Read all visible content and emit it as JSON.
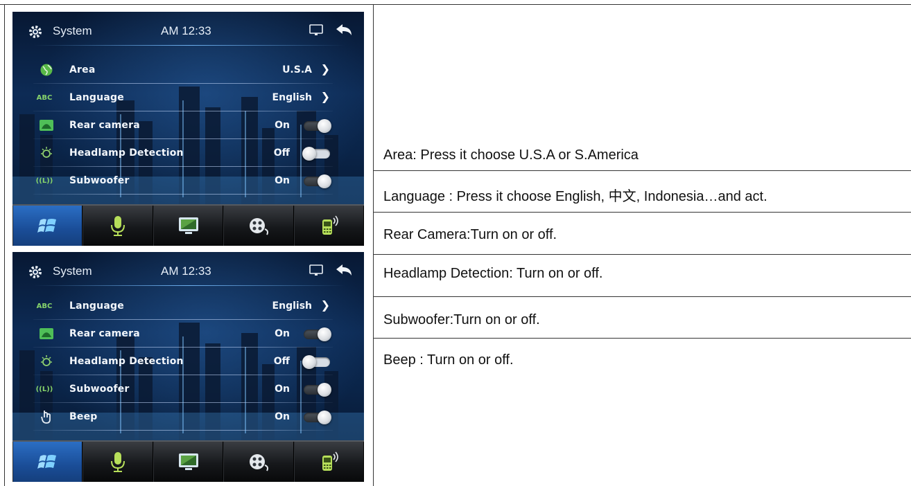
{
  "screens": [
    {
      "title": "System",
      "clock": "AM 12:33",
      "rows": [
        {
          "icon": "globe-icon",
          "label": "Area",
          "value": "U.S.A",
          "control": "chevron"
        },
        {
          "icon": "abc-icon",
          "icon_text": "ABC",
          "label": "Language",
          "value": "English",
          "control": "chevron"
        },
        {
          "icon": "camera-icon",
          "label": "Rear camera",
          "value": "On",
          "control": "toggle",
          "state": "on"
        },
        {
          "icon": "headlamp-icon",
          "label": "Headlamp Detection",
          "value": "Off",
          "control": "toggle",
          "state": "off"
        },
        {
          "icon": "subwoofer-icon",
          "icon_text": "((L))",
          "label": "Subwoofer",
          "value": "On",
          "control": "toggle",
          "state": "on"
        }
      ]
    },
    {
      "title": "System",
      "clock": "AM 12:33",
      "rows": [
        {
          "icon": "abc-icon",
          "icon_text": "ABC",
          "label": "Language",
          "value": "English",
          "control": "chevron"
        },
        {
          "icon": "camera-icon",
          "label": "Rear camera",
          "value": "On",
          "control": "toggle",
          "state": "on"
        },
        {
          "icon": "headlamp-icon",
          "label": "Headlamp Detection",
          "value": "Off",
          "control": "toggle",
          "state": "off"
        },
        {
          "icon": "subwoofer-icon",
          "icon_text": "((L))",
          "label": "Subwoofer",
          "value": "On",
          "control": "toggle",
          "state": "on"
        },
        {
          "icon": "beep-icon",
          "label": "Beep",
          "value": "On",
          "control": "toggle",
          "state": "on"
        }
      ]
    }
  ],
  "dock": [
    "home-icon",
    "microphone-icon",
    "monitor-icon",
    "media-icon",
    "phone-icon"
  ],
  "colors": {
    "accent_blue": "#1a4d97",
    "toggle_on": "#2a2f35",
    "toggle_off": "#d7dde5"
  },
  "descriptions": [
    "Area: Press it choose U.S.A or S.America",
    "Language : Press it choose English, 中文, Indonesia…and act.",
    "Rear Camera:Turn on or off.",
    "Headlamp Detection: Turn on or off.",
    "Subwoofer:Turn on or off.",
    "Beep : Turn on or off."
  ]
}
